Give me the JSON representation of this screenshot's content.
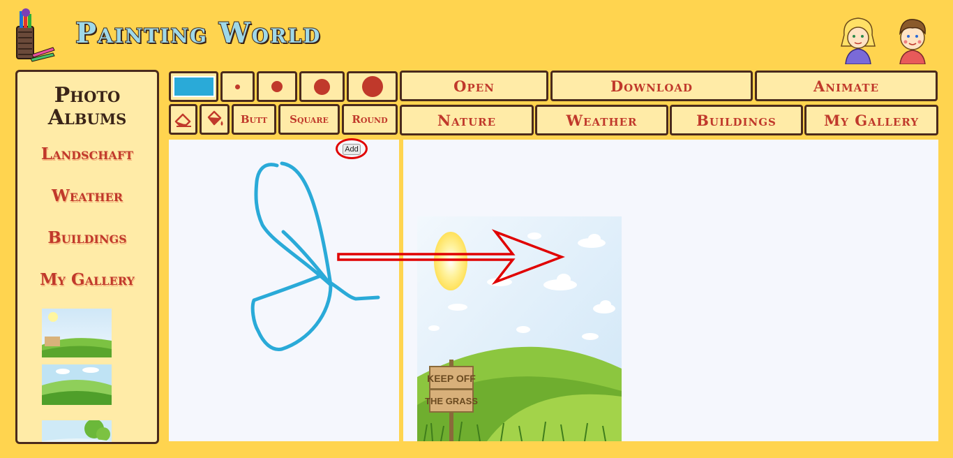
{
  "header": {
    "title": "Painting World"
  },
  "sidebar": {
    "heading_line1": "Photo",
    "heading_line2": "Albums",
    "albums": [
      "Landschaft",
      "Weather",
      "Buildings",
      "My Gallery"
    ]
  },
  "toolbar": {
    "current_color": "#2AAAD8",
    "line_caps": [
      "Butt",
      "Square",
      "Round"
    ]
  },
  "menu": {
    "top": [
      "Open",
      "Download",
      "Animate"
    ],
    "categories": [
      "Nature",
      "Weather",
      "Buildings",
      "My Gallery"
    ]
  },
  "canvas": {
    "add_label": "Add"
  },
  "preview": {
    "sign_line1": "KEEP OFF",
    "sign_line2": "THE GRASS"
  },
  "colors": {
    "background": "#FFD44F",
    "panel": "#FFEBA7",
    "accent": "#c0392b",
    "border": "#4a2a1c",
    "stroke": "#2AAAD8",
    "annotation": "#e00000"
  }
}
